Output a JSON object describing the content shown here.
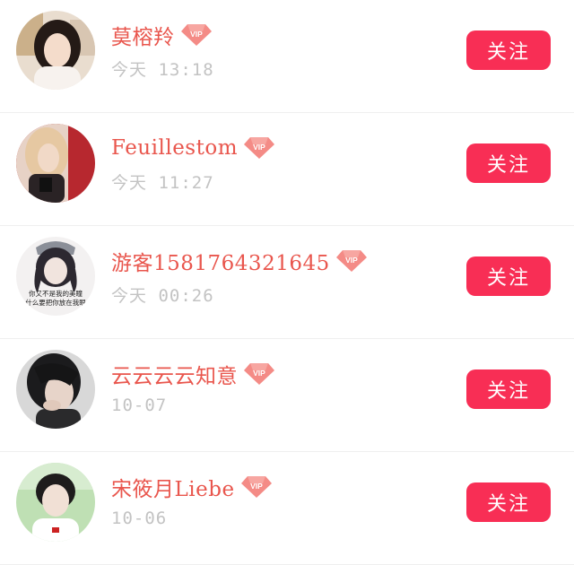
{
  "follow_label": "关注",
  "vip_label": "VIP",
  "colors": {
    "name": "#e9564d",
    "time": "#c3c3c3",
    "follow_button": "#f82e55",
    "vip_badge": "#f48b86"
  },
  "users": [
    {
      "name": "莫榕羚",
      "time": "今天 13:18",
      "avatar_icon": "portrait-photo"
    },
    {
      "name": "Feuillestom",
      "time": "今天 11:27",
      "avatar_icon": "portrait-photo"
    },
    {
      "name": "游客1581764321645",
      "time": "今天 00:26",
      "avatar_icon": "anime-portrait",
      "avatar_caption": [
        "你又不是我的美瞳",
        "什么要把你放在我眼"
      ]
    },
    {
      "name": "云云云云知意",
      "time": "10-07",
      "avatar_icon": "portrait-photo"
    },
    {
      "name": "宋筱月Liebe",
      "time": "10-06",
      "avatar_icon": "portrait-photo"
    }
  ]
}
